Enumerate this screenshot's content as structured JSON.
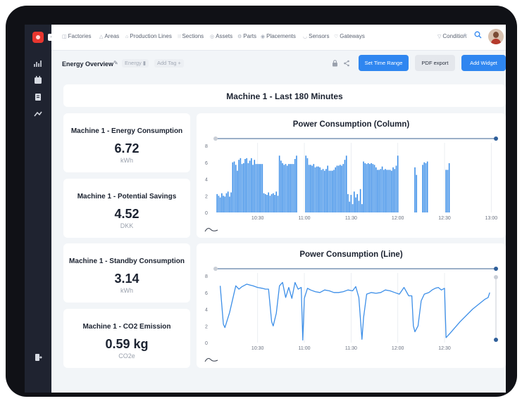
{
  "nav": {
    "items": [
      {
        "label": "Factories",
        "icon": "factory-icon"
      },
      {
        "label": "Areas",
        "icon": "area-icon"
      },
      {
        "label": "Production Lines",
        "icon": "production-line-icon"
      },
      {
        "label": "Sections",
        "icon": "section-icon"
      },
      {
        "label": "Assets",
        "icon": "asset-icon"
      },
      {
        "label": "Parts",
        "icon": "part-icon"
      },
      {
        "label": "Placements",
        "icon": "placement-icon"
      },
      {
        "label": "Sensors",
        "icon": "sensor-icon"
      },
      {
        "label": "Gateways",
        "icon": "gateway-icon"
      }
    ],
    "condition": "Condition"
  },
  "toolbar": {
    "title": "Energy Overview",
    "tag": "Energy",
    "add_tag": "Add Tag +",
    "set_time_range": "Set Time Range",
    "pdf_export": "PDF export",
    "add_widget": "Add Widget"
  },
  "banner": {
    "title": "Machine 1 - Last 180 Minutes"
  },
  "kpis": [
    {
      "title": "Machine 1 - Energy Consumption",
      "value": "6.72",
      "unit": "kWh"
    },
    {
      "title": "Machine 1 - Potential Savings",
      "value": "4.52",
      "unit": "DKK"
    },
    {
      "title": "Machine 1 - Standby Consumption",
      "value": "3.14",
      "unit": "kWh"
    },
    {
      "title": "Machine 1 - CO2 Emission",
      "value": "0.59 kg",
      "unit": "CO2e"
    }
  ],
  "colors": {
    "accent": "#2f86f0",
    "chart": "#3d8fe8",
    "sidebar": "#1f2330"
  },
  "chart_data": [
    {
      "type": "bar",
      "title": "Power Consumption (Column)",
      "ylim": [
        0,
        8
      ],
      "yticks": [
        0,
        2,
        4,
        6,
        8
      ],
      "xlim": [
        "10:03",
        "13:03"
      ],
      "xticks": [
        "10:30",
        "11:00",
        "11:30",
        "12:00",
        "12:30",
        "13:00"
      ],
      "grid": "vertical",
      "bar_interval_minutes": 1,
      "bars_start": "10:04",
      "values": [
        2.2,
        2.0,
        1.8,
        2.3,
        2.0,
        1.9,
        2.3,
        2.5,
        1.9,
        2.4,
        6.0,
        6.1,
        5.7,
        5.0,
        6.3,
        6.5,
        5.8,
        5.9,
        6.4,
        6.5,
        5.9,
        6.2,
        6.5,
        5.7,
        6.3,
        5.8,
        5.8,
        5.8,
        5.8,
        5.8,
        2.3,
        2.2,
        2.1,
        2.4,
        2.0,
        2.2,
        2.3,
        2.1,
        2.5,
        2.0,
        6.8,
        6.2,
        5.9,
        5.7,
        5.8,
        5.6,
        5.8,
        5.8,
        5.8,
        5.8,
        6.4,
        6.8,
        null,
        null,
        null,
        null,
        null,
        6.8,
        6.5,
        5.7,
        5.7,
        5.6,
        5.8,
        5.4,
        5.5,
        5.5,
        5.4,
        5.1,
        5.2,
        5.0,
        5.2,
        5.6,
        5.0,
        5.0,
        5.0,
        5.1,
        5.4,
        5.6,
        5.6,
        5.7,
        5.6,
        5.8,
        6.3,
        6.8,
        2.2,
        1.3,
        2.1,
        1.0,
        2.5,
        1.8,
        2.2,
        1.4,
        2.8,
        1.0,
        6.1,
        5.9,
        5.8,
        5.9,
        5.8,
        5.9,
        5.8,
        5.7,
        5.4,
        5.1,
        5.1,
        5.2,
        5.5,
        5.1,
        5.2,
        5.1,
        5.1,
        5.1,
        5.0,
        5.4,
        5.2,
        5.6,
        6.8,
        null,
        null,
        null,
        null,
        null,
        null,
        null,
        null,
        null,
        null,
        5.4,
        4.5,
        null,
        null,
        null,
        5.7,
        6.0,
        5.9,
        6.1,
        null,
        null,
        null,
        null,
        null,
        null,
        null,
        null,
        null,
        null,
        null,
        5.1,
        5.1,
        5.9
      ],
      "range_slider": true
    },
    {
      "type": "line",
      "title": "Power Consumption (Line)",
      "ylim": [
        0,
        8
      ],
      "yticks": [
        0,
        2,
        4,
        6,
        8
      ],
      "xlim": [
        "10:03",
        "13:03"
      ],
      "xticks": [
        "10:30",
        "11:00",
        "11:30",
        "12:00",
        "12:30"
      ],
      "grid": "vertical",
      "points": [
        [
          "10:06",
          6.8
        ],
        [
          "10:08",
          2.2
        ],
        [
          "10:09",
          1.8
        ],
        [
          "10:12",
          3.6
        ],
        [
          "10:14",
          5.2
        ],
        [
          "10:16",
          6.8
        ],
        [
          "10:18",
          6.4
        ],
        [
          "10:20",
          6.7
        ],
        [
          "10:23",
          7.0
        ],
        [
          "10:25",
          6.9
        ],
        [
          "10:27",
          6.8
        ],
        [
          "10:30",
          6.6
        ],
        [
          "10:33",
          6.5
        ],
        [
          "10:35",
          6.4
        ],
        [
          "10:37",
          6.4
        ],
        [
          "10:39",
          2.5
        ],
        [
          "10:40",
          2.0
        ],
        [
          "10:42",
          3.5
        ],
        [
          "10:44",
          6.8
        ],
        [
          "10:46",
          7.2
        ],
        [
          "10:48",
          5.4
        ],
        [
          "10:50",
          6.6
        ],
        [
          "10:52",
          5.3
        ],
        [
          "10:54",
          7.2
        ],
        [
          "10:56",
          6.4
        ],
        [
          "10:58",
          6.6
        ],
        [
          "10:59",
          0.3
        ],
        [
          "11:00",
          5.3
        ],
        [
          "11:02",
          6.5
        ],
        [
          "11:04",
          6.3
        ],
        [
          "11:07",
          6.1
        ],
        [
          "11:10",
          6.0
        ],
        [
          "11:13",
          6.3
        ],
        [
          "11:16",
          6.2
        ],
        [
          "11:19",
          6.0
        ],
        [
          "11:22",
          6.0
        ],
        [
          "11:25",
          6.1
        ],
        [
          "11:28",
          6.3
        ],
        [
          "11:31",
          6.2
        ],
        [
          "11:33",
          6.7
        ],
        [
          "11:35",
          5.4
        ],
        [
          "11:37",
          0.4
        ],
        [
          "11:38",
          3.0
        ],
        [
          "11:40",
          5.8
        ],
        [
          "11:43",
          6.0
        ],
        [
          "11:46",
          5.9
        ],
        [
          "11:49",
          6.0
        ],
        [
          "11:52",
          6.3
        ],
        [
          "11:55",
          6.2
        ],
        [
          "11:58",
          6.0
        ],
        [
          "12:01",
          5.8
        ],
        [
          "12:04",
          6.6
        ],
        [
          "12:07",
          5.6
        ],
        [
          "12:09",
          5.6
        ],
        [
          "12:10",
          2.0
        ],
        [
          "12:11",
          1.3
        ],
        [
          "12:13",
          2.0
        ],
        [
          "12:15",
          5.0
        ],
        [
          "12:17",
          5.8
        ],
        [
          "12:20",
          6.0
        ],
        [
          "12:22",
          6.3
        ],
        [
          "12:24",
          6.5
        ],
        [
          "12:26",
          6.6
        ],
        [
          "12:28",
          6.3
        ],
        [
          "12:30",
          6.5
        ],
        [
          "12:31",
          0.6
        ],
        [
          "12:33",
          1.0
        ],
        [
          "12:40",
          2.5
        ],
        [
          "12:48",
          4.0
        ],
        [
          "12:56",
          5.2
        ],
        [
          "12:58",
          5.4
        ],
        [
          "12:59",
          6.0
        ]
      ],
      "range_slider": true
    }
  ]
}
